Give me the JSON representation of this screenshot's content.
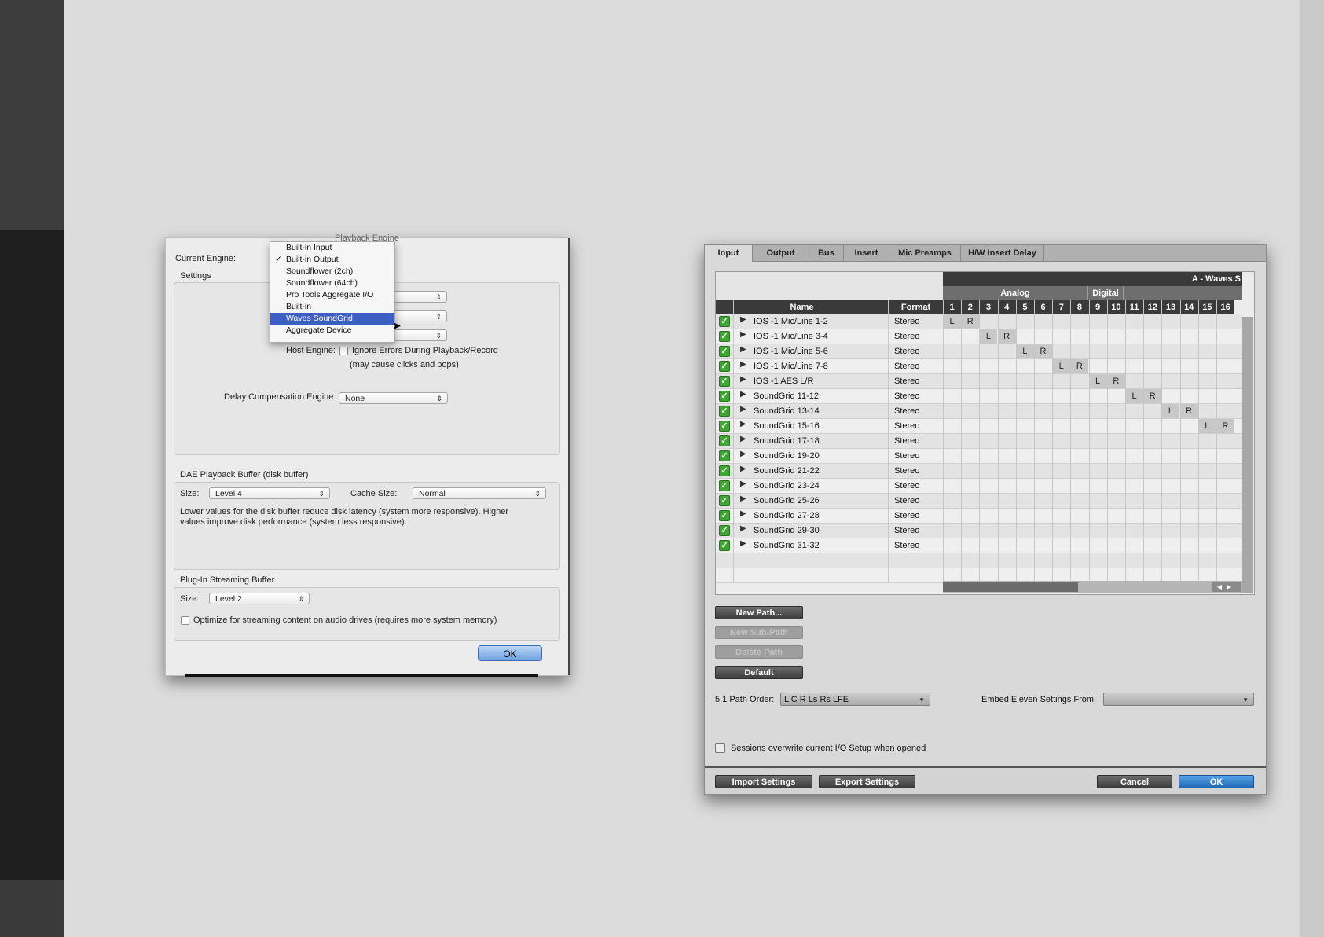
{
  "playback_engine": {
    "title": "Playback Engine",
    "current_engine_label": "Current Engine:",
    "settings_label": "Settings",
    "engine_menu": [
      {
        "label": "Built-in Input",
        "checked": false,
        "selected": false
      },
      {
        "label": "Built-in Output",
        "checked": true,
        "selected": false
      },
      {
        "label": "Soundflower (2ch)",
        "checked": false,
        "selected": false
      },
      {
        "label": "Soundflower (64ch)",
        "checked": false,
        "selected": false
      },
      {
        "label": "Pro Tools Aggregate I/O",
        "checked": false,
        "selected": false
      },
      {
        "label": "Built-in",
        "checked": false,
        "selected": false
      },
      {
        "label": "Waves SoundGrid",
        "checked": false,
        "selected": true
      },
      {
        "label": "Aggregate Device",
        "checked": false,
        "selected": false
      }
    ],
    "check_mark": "✓",
    "host_engine_label": "Host Engine:",
    "ignore_errors_label": "Ignore Errors During Playback/Record",
    "ignore_errors_note": "(may cause clicks and pops)",
    "delay_comp_label": "Delay Compensation Engine:",
    "delay_comp_value": "None",
    "dae_buffer_title": "DAE Playback Buffer (disk buffer)",
    "size_label": "Size:",
    "dae_size_value": "Level 4",
    "cache_size_label": "Cache Size:",
    "cache_size_value": "Normal",
    "dae_note_1": "Lower values for the disk buffer reduce disk latency (system more responsive).  Higher",
    "dae_note_2": "values improve disk performance (system less responsive).",
    "plugin_buffer_title": "Plug-In Streaming Buffer",
    "plugin_size_value": "Level 2",
    "optimize_label": "Optimize for streaming content on audio drives (requires more system memory)",
    "ok_label": "OK"
  },
  "io_setup": {
    "tabs": [
      {
        "label": "Input",
        "active": true
      },
      {
        "label": "Output",
        "active": false
      },
      {
        "label": "Bus",
        "active": false
      },
      {
        "label": "Insert",
        "active": false
      },
      {
        "label": "Mic Preamps",
        "active": false
      },
      {
        "label": "H/W Insert Delay",
        "active": false
      }
    ],
    "device_header": "A - Waves S",
    "group_analog": "Analog",
    "group_digital": "Digital",
    "col_name": "Name",
    "col_format": "Format",
    "channels": [
      "1",
      "2",
      "3",
      "4",
      "5",
      "6",
      "7",
      "8",
      "9",
      "10",
      "11",
      "12",
      "13",
      "14",
      "15",
      "16"
    ],
    "rows": [
      {
        "name": "IOS -1 Mic/Line 1-2",
        "format": "Stereo",
        "start": 1
      },
      {
        "name": "IOS -1 Mic/Line 3-4",
        "format": "Stereo",
        "start": 3
      },
      {
        "name": "IOS -1 Mic/Line 5-6",
        "format": "Stereo",
        "start": 5
      },
      {
        "name": "IOS -1 Mic/Line 7-8",
        "format": "Stereo",
        "start": 7
      },
      {
        "name": "IOS -1 AES  L/R",
        "format": "Stereo",
        "start": 9
      },
      {
        "name": "SoundGrid 11-12",
        "format": "Stereo",
        "start": 11
      },
      {
        "name": "SoundGrid 13-14",
        "format": "Stereo",
        "start": 13
      },
      {
        "name": "SoundGrid 15-16",
        "format": "Stereo",
        "start": 15
      },
      {
        "name": "SoundGrid 17-18",
        "format": "Stereo",
        "start": 0
      },
      {
        "name": "SoundGrid 19-20",
        "format": "Stereo",
        "start": 0
      },
      {
        "name": "SoundGrid 21-22",
        "format": "Stereo",
        "start": 0
      },
      {
        "name": "SoundGrid 23-24",
        "format": "Stereo",
        "start": 0
      },
      {
        "name": "SoundGrid 25-26",
        "format": "Stereo",
        "start": 0
      },
      {
        "name": "SoundGrid 27-28",
        "format": "Stereo",
        "start": 0
      },
      {
        "name": "SoundGrid 29-30",
        "format": "Stereo",
        "start": 0
      },
      {
        "name": "SoundGrid 31-32",
        "format": "Stereo",
        "start": 0
      }
    ],
    "assign_left": "L",
    "assign_right": "R",
    "check_glyph": "✓",
    "expand_glyph": "▶",
    "new_path_label": "New Path...",
    "new_sub_path_label": "New Sub-Path",
    "delete_path_label": "Delete Path",
    "default_label": "Default",
    "path_order_label": "5.1 Path Order:",
    "path_order_value": "L C R Ls Rs LFE",
    "embed_label": "Embed Eleven Settings From:",
    "embed_value": "",
    "sessions_overwrite_label": "Sessions overwrite current I/O Setup when opened",
    "import_label": "Import Settings",
    "export_label": "Export Settings",
    "cancel_label": "Cancel",
    "ok_label": "OK"
  }
}
